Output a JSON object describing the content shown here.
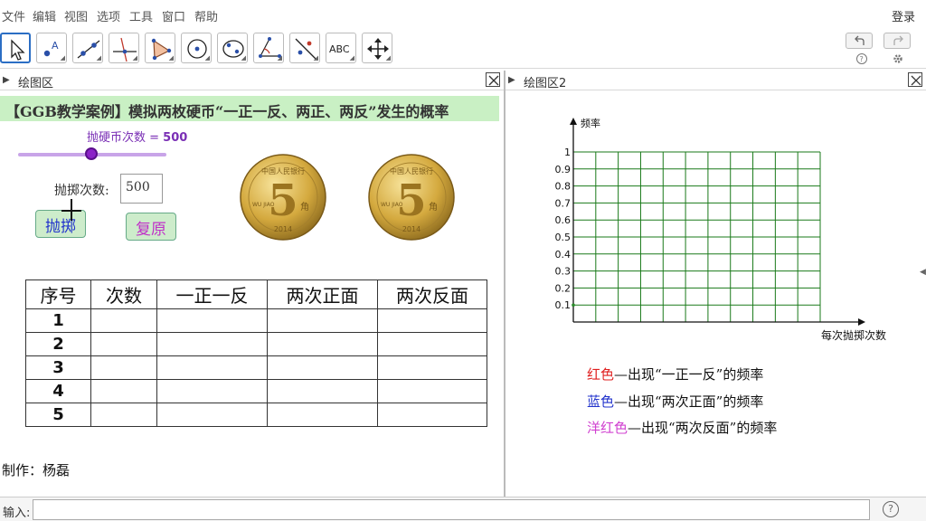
{
  "menu": [
    "文件",
    "编辑",
    "视图",
    "选项",
    "工具",
    "窗口",
    "帮助"
  ],
  "login": "登录",
  "tools": [
    {
      "name": "move-tool-icon"
    },
    {
      "name": "point-tool-icon"
    },
    {
      "name": "line-tool-icon"
    },
    {
      "name": "perpendicular-tool-icon"
    },
    {
      "name": "polygon-tool-icon"
    },
    {
      "name": "circle-tool-icon"
    },
    {
      "name": "ellipse-tool-icon"
    },
    {
      "name": "angle-tool-icon"
    },
    {
      "name": "reflect-tool-icon"
    },
    {
      "name": "text-tool-icon",
      "text": "ABC"
    },
    {
      "name": "move-graphics-view-icon"
    }
  ],
  "left_panel": {
    "title": "绘图区",
    "banner_parts": [
      {
        "text": "【GGB教学案例】",
        "color": "#1a7a1a"
      },
      {
        "text": "模拟两枚硬币“一正一反、两正、两反”发生的概率",
        "color": "#e02020"
      }
    ],
    "slider": {
      "label": "抛硬币次数 = ",
      "value": "500",
      "fraction": 0.5
    },
    "throw_label": "抛掷次数:",
    "throw_value": "500",
    "btn_throw": "抛掷",
    "btn_reset": "复原",
    "coin": {
      "numeral": "5",
      "unit": "角",
      "year": "2014",
      "top_text": "中国人民银行",
      "pinyin": "WU JIAO"
    },
    "table": {
      "headers": [
        "序号",
        "次数",
        "一正一反",
        "两次正面",
        "两次反面"
      ],
      "rows": [
        [
          "1",
          "",
          "",
          "",
          ""
        ],
        [
          "2",
          "",
          "",
          "",
          ""
        ],
        [
          "3",
          "",
          "",
          "",
          ""
        ],
        [
          "4",
          "",
          "",
          "",
          ""
        ],
        [
          "5",
          "",
          "",
          "",
          ""
        ]
      ]
    },
    "author": "制作：杨磊"
  },
  "right_panel": {
    "title": "绘图区2",
    "legend": [
      {
        "color_name": "红色",
        "color": "#e02020",
        "text": "—出现“一正一反”的频率"
      },
      {
        "color_name": "蓝色",
        "color": "#2233cc",
        "text": "—出现“两次正面”的频率"
      },
      {
        "color_name": "洋红色",
        "color": "#d040d0",
        "text": "—出现“两次反面”的频率"
      }
    ]
  },
  "chart_data": {
    "type": "line",
    "ylabel": "频率",
    "xlabel": "每次抛掷次数",
    "yticks": [
      "0.1",
      "0.2",
      "0.3",
      "0.4",
      "0.5",
      "0.6",
      "0.7",
      "0.8",
      "0.9",
      "1"
    ],
    "ylim": [
      0,
      1
    ],
    "grid": true,
    "grid_color": "#1a7a1a",
    "grid_columns": 11,
    "grid_rows": 10,
    "series": []
  },
  "input_bar": {
    "label": "输入:",
    "value": "",
    "help": "?"
  }
}
